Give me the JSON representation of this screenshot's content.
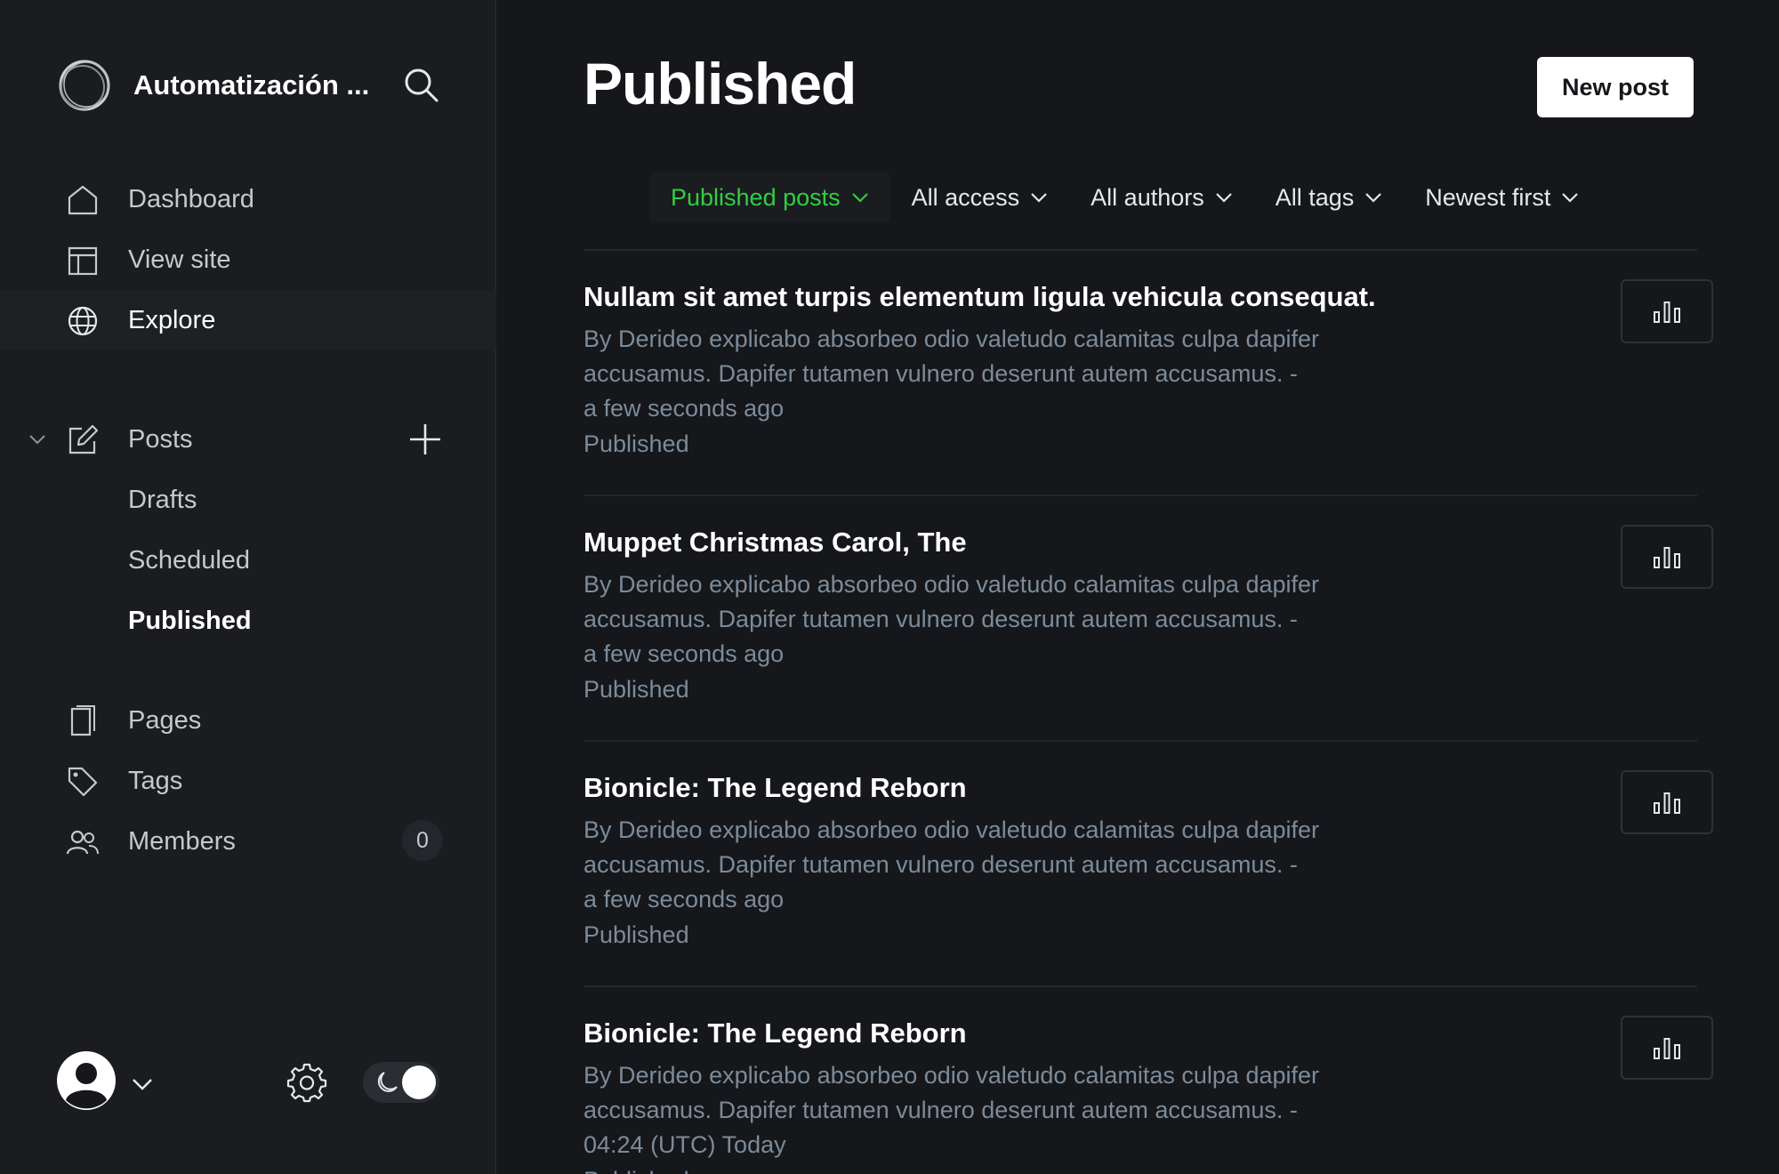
{
  "sidebar": {
    "site_title": "Automatización ...",
    "search_icon": "search-icon",
    "nav": [
      {
        "label": "Dashboard",
        "icon": "home-icon"
      },
      {
        "label": "View site",
        "icon": "layout-icon"
      },
      {
        "label": "Explore",
        "icon": "globe-icon"
      }
    ],
    "posts": {
      "label": "Posts",
      "icon": "edit-icon",
      "sub": [
        {
          "label": "Drafts"
        },
        {
          "label": "Scheduled"
        },
        {
          "label": "Published"
        }
      ]
    },
    "more": [
      {
        "label": "Pages",
        "icon": "page-icon"
      },
      {
        "label": "Tags",
        "icon": "tag-icon"
      },
      {
        "label": "Members",
        "icon": "members-icon",
        "count": "0"
      }
    ]
  },
  "main": {
    "title": "Published",
    "new_post_label": "New post",
    "filters": [
      {
        "label": "Published posts",
        "active": true
      },
      {
        "label": "All access"
      },
      {
        "label": "All authors"
      },
      {
        "label": "All tags"
      },
      {
        "label": "Newest first"
      }
    ],
    "posts": [
      {
        "title": "Nullam sit amet turpis elementum ligula vehicula consequat.",
        "meta": "By Derideo explicabo absorbeo odio valetudo calamitas culpa dapifer accusamus. Dapifer tutamen vulnero deserunt autem accusamus. -",
        "time": "a few seconds ago",
        "status": "Published"
      },
      {
        "title": "Muppet Christmas Carol, The",
        "meta": "By Derideo explicabo absorbeo odio valetudo calamitas culpa dapifer accusamus. Dapifer tutamen vulnero deserunt autem accusamus. -",
        "time": "a few seconds ago",
        "status": "Published"
      },
      {
        "title": "Bionicle: The Legend Reborn",
        "meta": "By Derideo explicabo absorbeo odio valetudo calamitas culpa dapifer accusamus. Dapifer tutamen vulnero deserunt autem accusamus. -",
        "time": "a few seconds ago",
        "status": "Published"
      },
      {
        "title": "Bionicle: The Legend Reborn",
        "meta": "By Derideo explicabo absorbeo odio valetudo calamitas culpa dapifer accusamus. Dapifer tutamen vulnero deserunt autem accusamus. -",
        "time": "04:24 (UTC) Today",
        "status": "Published"
      }
    ]
  },
  "colors": {
    "background": "#15171a",
    "sidebar": "#1a1c1f",
    "accent_green": "#30cf43",
    "muted_text": "#7c8b9a"
  }
}
